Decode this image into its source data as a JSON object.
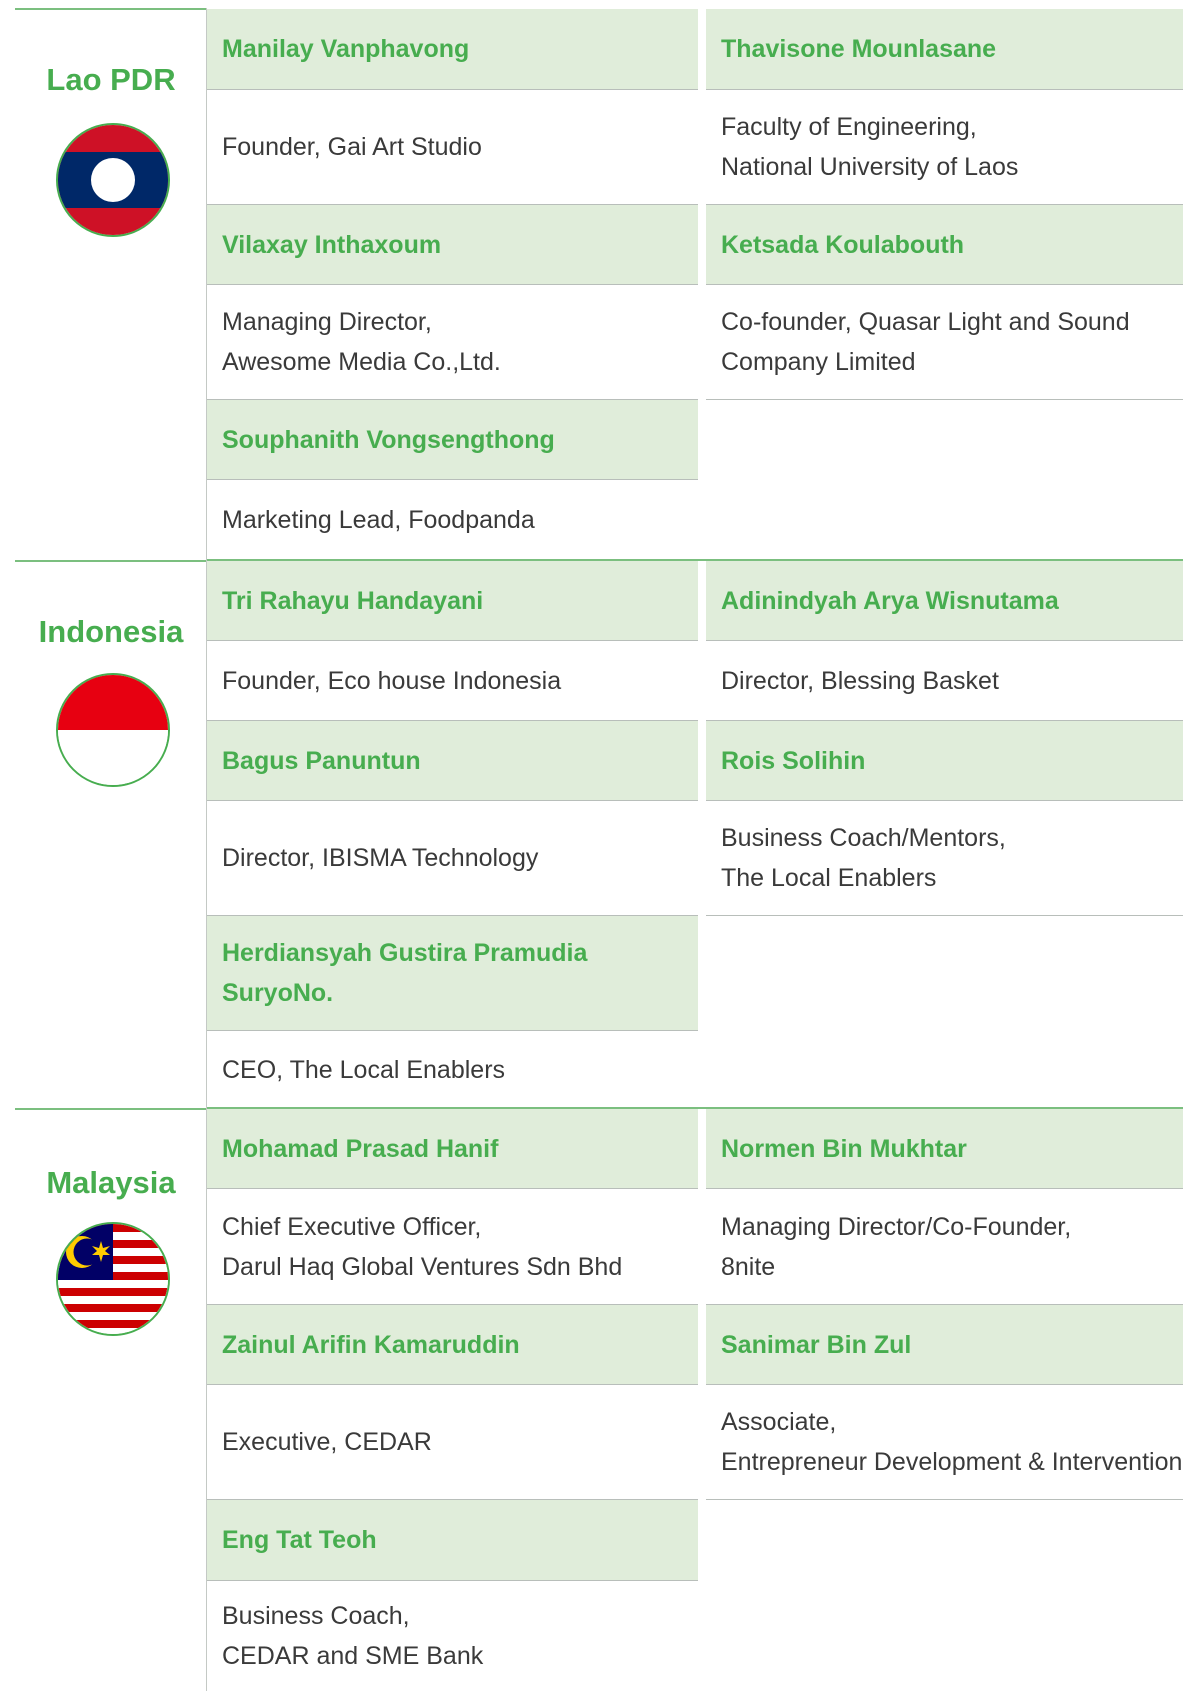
{
  "countries": [
    {
      "name": "Lao PDR",
      "flag": "lao-flag",
      "people": [
        {
          "name": "Manilay Vanphavong",
          "role": [
            "Founder, Gai Art Studio"
          ]
        },
        {
          "name": "Thavisone Mounlasane",
          "role": [
            "Faculty of Engineering,",
            "National University of Laos"
          ]
        },
        {
          "name": "Vilaxay Inthaxoum",
          "role": [
            "Managing Director,",
            "Awesome Media Co.,Ltd."
          ]
        },
        {
          "name": "Ketsada Koulabouth",
          "role": [
            "Co-founder, Quasar Light and Sound",
            "Company Limited"
          ]
        },
        {
          "name": "Souphanith Vongsengthong",
          "role": [
            "Marketing Lead, Foodpanda"
          ]
        }
      ]
    },
    {
      "name": "Indonesia",
      "flag": "indonesia-flag",
      "people": [
        {
          "name": "Tri Rahayu Handayani",
          "role": [
            "Founder, Eco house Indonesia"
          ]
        },
        {
          "name": "Adinindyah Arya Wisnutama",
          "role": [
            "Director, Blessing Basket"
          ]
        },
        {
          "name": "Bagus Panuntun",
          "role": [
            "Director, IBISMA Technology"
          ]
        },
        {
          "name": "Rois Solihin",
          "role": [
            "Business Coach/Mentors,",
            "The Local Enablers"
          ]
        },
        {
          "name": [
            "Herdiansyah Gustira Pramudia",
            "SuryoNo."
          ],
          "role": [
            "CEO, The Local Enablers"
          ]
        }
      ]
    },
    {
      "name": "Malaysia",
      "flag": "malaysia-flag",
      "people": [
        {
          "name": "Mohamad Prasad Hanif",
          "role": [
            "Chief Executive Officer,",
            "Darul Haq Global Ventures Sdn Bhd"
          ]
        },
        {
          "name": "Normen Bin Mukhtar",
          "role": [
            "Managing Director/Co-Founder,",
            "8nite"
          ]
        },
        {
          "name": "Zainul Arifin Kamaruddin",
          "role": [
            "Executive, CEDAR"
          ]
        },
        {
          "name": "Sanimar Bin Zul",
          "role": [
            "Associate,",
            "Entrepreneur Development & Intervention"
          ]
        },
        {
          "name": "Eng Tat Teoh",
          "role": [
            "Business Coach,",
            "CEDAR and SME Bank"
          ]
        }
      ]
    }
  ],
  "colors": {
    "accent": "#47ad4f",
    "name_bg": "#e0edda",
    "text": "#3a3a3a"
  }
}
